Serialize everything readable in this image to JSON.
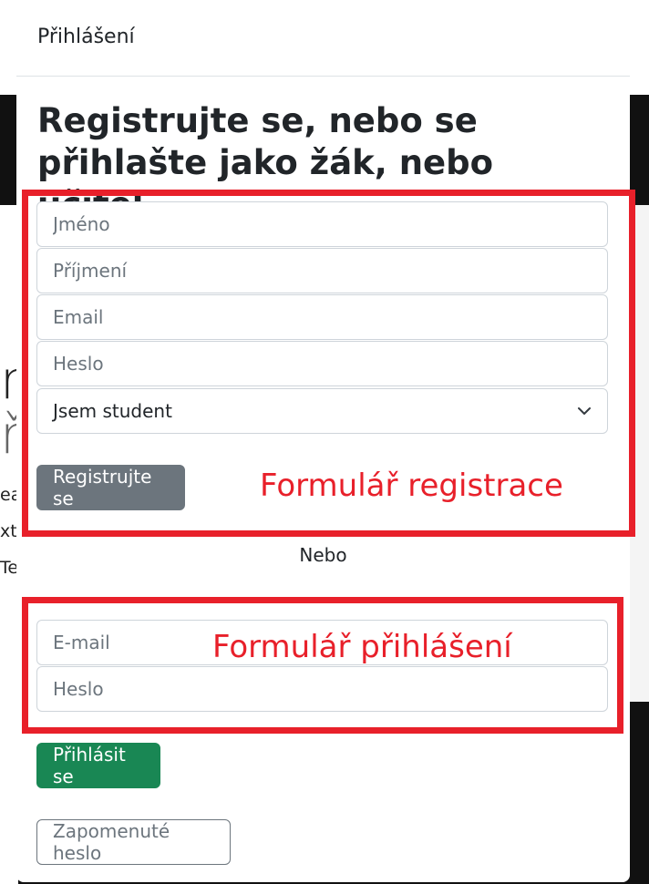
{
  "background": {
    "fragments": [
      "n",
      "ř",
      "ea",
      "xt",
      "Te"
    ]
  },
  "modal": {
    "title": "Přihlášení",
    "heading": "Registrujte se, nebo se přihlašte jako žák, nebo učitel."
  },
  "register_form": {
    "first_name_placeholder": "Jméno",
    "last_name_placeholder": "Příjmení",
    "email_placeholder": "Email",
    "password_placeholder": "Heslo",
    "role_selected": "Jsem student",
    "submit_label": "Registrujte se"
  },
  "separator": "Nebo",
  "login_form": {
    "email_placeholder": "E-mail",
    "password_placeholder": "Heslo",
    "submit_label": "Přihlásit se",
    "forgot_label": "Zapomenuté heslo"
  },
  "annotations": {
    "register_label": "Formulář registrace",
    "login_label": "Formulář přihlášení",
    "color": "#e8202a"
  },
  "colors": {
    "secondary": "#6c757d",
    "success": "#198754",
    "text": "#212529"
  },
  "icons": {
    "select_arrow": "chevron-down-icon"
  }
}
